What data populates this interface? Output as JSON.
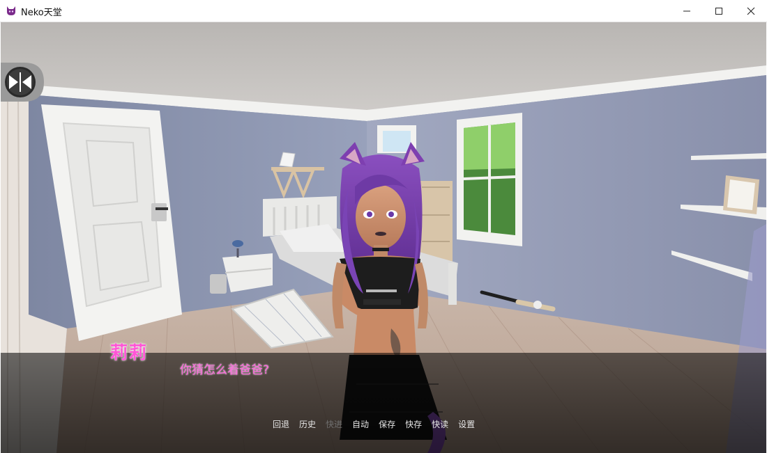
{
  "window": {
    "title": "Neko天堂",
    "controls": {
      "minimize_icon": "minimize-icon",
      "maximize_icon": "maximize-icon",
      "close_icon": "close-icon"
    }
  },
  "dialogue": {
    "speaker": "莉莉",
    "text": "你猜怎么着爸爸?",
    "speaker_color": "#ff55d6",
    "text_color": "#ff66dd"
  },
  "quick_menu": [
    {
      "label": "回退",
      "enabled": true
    },
    {
      "label": "历史",
      "enabled": true
    },
    {
      "label": "快进",
      "enabled": false
    },
    {
      "label": "自动",
      "enabled": true
    },
    {
      "label": "保存",
      "enabled": true
    },
    {
      "label": "快存",
      "enabled": true
    },
    {
      "label": "快读",
      "enabled": true
    },
    {
      "label": "设置",
      "enabled": true
    }
  ],
  "side_toggle": {
    "icon": "split-toggle-icon"
  }
}
